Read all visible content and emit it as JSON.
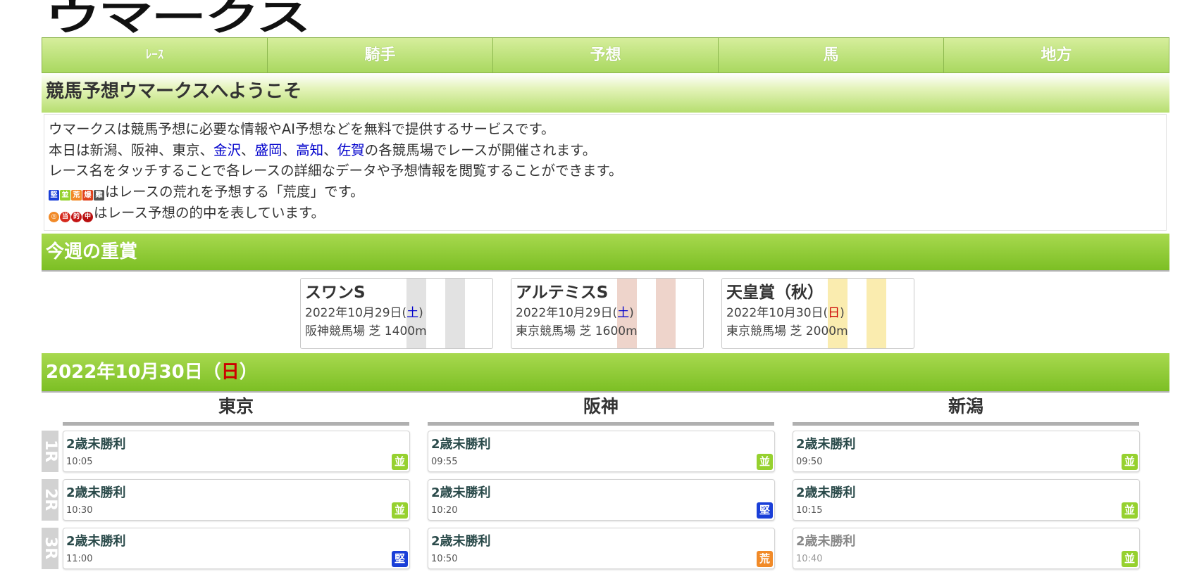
{
  "logo": {
    "text": "ウマークス"
  },
  "nav": {
    "items": [
      "ﾚｰｽ",
      "騎手",
      "予想",
      "馬",
      "地方"
    ]
  },
  "welcome": {
    "title": "競馬予想ウマークスへようこそ"
  },
  "intro": {
    "line1": "ウマークスは競馬予想に必要な情報やAI予想などを無料で提供するサービスです。",
    "line2_pre": "本日は新潟、阪神、東京、",
    "line2_links": [
      "金沢",
      "盛岡",
      "高知",
      "佐賀"
    ],
    "line2_sep": "、",
    "line2_post": "の各競馬場でレースが開催されます。",
    "line3": "レース名をタッチすることで各レースの詳細なデータや予想情報を閲覧することができます。",
    "line4": "はレースの荒れを予想する「荒度」です。",
    "line5": "はレース予想の的中を表しています。",
    "arado_badges": [
      {
        "label": "堅",
        "color": "#1a3fd8"
      },
      {
        "label": "並",
        "color": "#96d12f"
      },
      {
        "label": "荒",
        "color": "#f18a28"
      },
      {
        "label": "爆",
        "color": "#e0421c"
      },
      {
        "label": "難",
        "color": "#555555"
      }
    ],
    "hit_badges": [
      {
        "label": "◎",
        "color": "#f18a28"
      },
      {
        "label": "当",
        "color": "#d62a1e"
      },
      {
        "label": "的",
        "color": "#c41515"
      },
      {
        "label": "中",
        "color": "#b80f0f"
      }
    ]
  },
  "juushou": {
    "title": "今週の重賞",
    "races": [
      {
        "name": "スワンS",
        "date_pre": "2022年10月29日(",
        "dow": "土",
        "date_post": ")",
        "course": "阪神競馬場 芝 1400m",
        "dow_color": "blue",
        "grade_color": "#cfcfcf"
      },
      {
        "name": "アルテミスS",
        "date_pre": "2022年10月29日(",
        "dow": "土",
        "date_post": ")",
        "course": "東京競馬場 芝 1600m",
        "dow_color": "blue",
        "grade_color": "#e2b7a8"
      },
      {
        "name": "天皇賞（秋）",
        "date_pre": "2022年10月30日(",
        "dow": "日",
        "date_post": ")",
        "course": "東京競馬場 芝 2000m",
        "dow_color": "red",
        "grade_color": "#f7e07a"
      }
    ]
  },
  "date_header": {
    "pre": "2022年10月30日（",
    "dow": "日",
    "post": "）"
  },
  "venues": [
    "東京",
    "阪神",
    "新潟"
  ],
  "round_labels": [
    "1R",
    "2R",
    "3R"
  ],
  "races": {
    "tokyo": [
      {
        "name": "2歳未勝利",
        "time": "10:05",
        "badge": "並"
      },
      {
        "name": "2歳未勝利",
        "time": "10:30",
        "badge": "並"
      },
      {
        "name": "2歳未勝利",
        "time": "11:00",
        "badge": "堅"
      }
    ],
    "hanshin": [
      {
        "name": "2歳未勝利",
        "time": "09:55",
        "badge": "並"
      },
      {
        "name": "2歳未勝利",
        "time": "10:20",
        "badge": "堅"
      },
      {
        "name": "2歳未勝利",
        "time": "10:50",
        "badge": "荒"
      }
    ],
    "niigata": [
      {
        "name": "2歳未勝利",
        "time": "09:50",
        "badge": "並"
      },
      {
        "name": "2歳未勝利",
        "time": "10:15",
        "badge": "並"
      },
      {
        "name": "2歳未勝利",
        "time": "10:40",
        "badge": "並"
      }
    ]
  }
}
